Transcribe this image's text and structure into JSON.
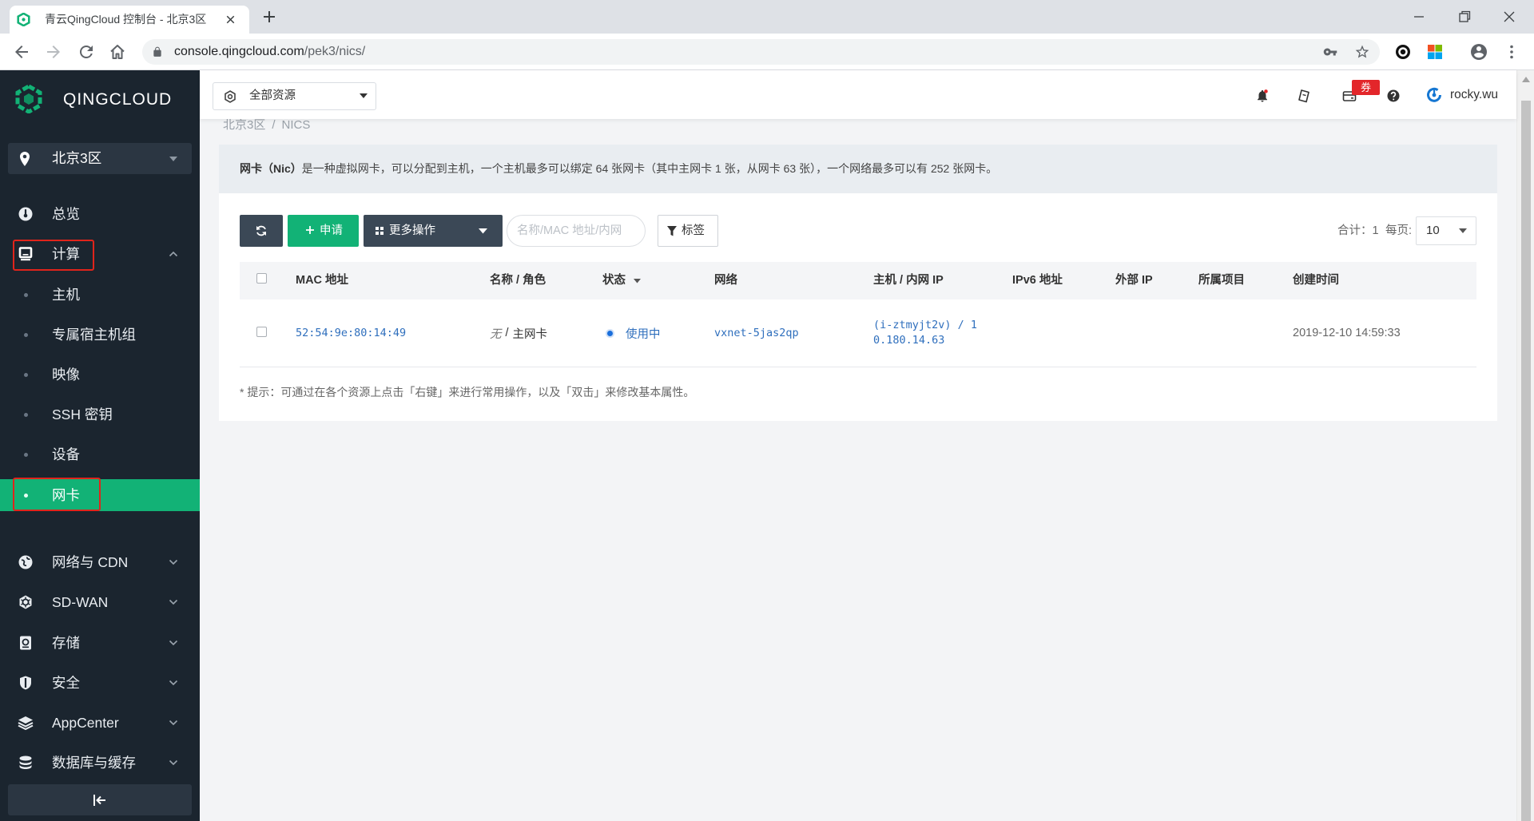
{
  "browser": {
    "tab_title": "青云QingCloud 控制台 - 北京3区",
    "url_host": "console.qingcloud.com",
    "url_path": "/pek3/nics/"
  },
  "sidebar": {
    "logo_text": "QINGCLOUD",
    "region": "北京3区",
    "overview": "总览",
    "compute": {
      "label": "计算",
      "expanded": true,
      "children": [
        "主机",
        "专属宿主机组",
        "映像",
        "SSH 密钥",
        "设备",
        "网卡"
      ],
      "active_index": 5
    },
    "sections": [
      "网络与 CDN",
      "SD-WAN",
      "存储",
      "安全",
      "AppCenter",
      "数据库与缓存"
    ]
  },
  "header": {
    "resource_scope": "全部资源",
    "coupon_badge": "券",
    "username": "rocky.wu"
  },
  "breadcrumb": {
    "region": "北京3区",
    "separator": "/",
    "page": "NICS"
  },
  "info": {
    "title": "网卡（Nic）",
    "text": "是一种虚拟网卡，可以分配到主机，一个主机最多可以绑定 64 张网卡（其中主网卡 1 张，从网卡 63 张），一个网络最多可以有 252 张网卡。"
  },
  "toolbar": {
    "apply_label": "申请",
    "more_label": "更多操作",
    "search_placeholder": "名称/MAC 地址/内网",
    "tag_label": "标签",
    "total_label": "合计：1",
    "per_page_label": "每页:",
    "page_size": "10"
  },
  "table": {
    "columns": [
      "MAC 地址",
      "名称 / 角色",
      "状态",
      "网络",
      "主机 / 内网 IP",
      "IPv6 地址",
      "外部 IP",
      "所属项目",
      "创建时间"
    ],
    "rows": [
      {
        "mac": "52:54:9e:80:14:49",
        "name": "无",
        "name_role_separator": "/",
        "role": "主网卡",
        "status": "使用中",
        "network": "vxnet-5jas2qp",
        "host_ip": "(i-ztmyjt2v) / 10.180.14.63",
        "created": "2019-12-10 14:59:33"
      }
    ]
  },
  "hint": "* 提示：可通过在各个资源上点击「右键」来进行常用操作，以及「双击」来修改基本属性。",
  "colors": {
    "brand_green": "#12b276",
    "sidebar_bg": "#1b252f",
    "link_blue": "#2f6fbd",
    "status_blue": "#1a6fdc",
    "badge_red": "#e3262a",
    "annotation_red": "#e0241b"
  }
}
